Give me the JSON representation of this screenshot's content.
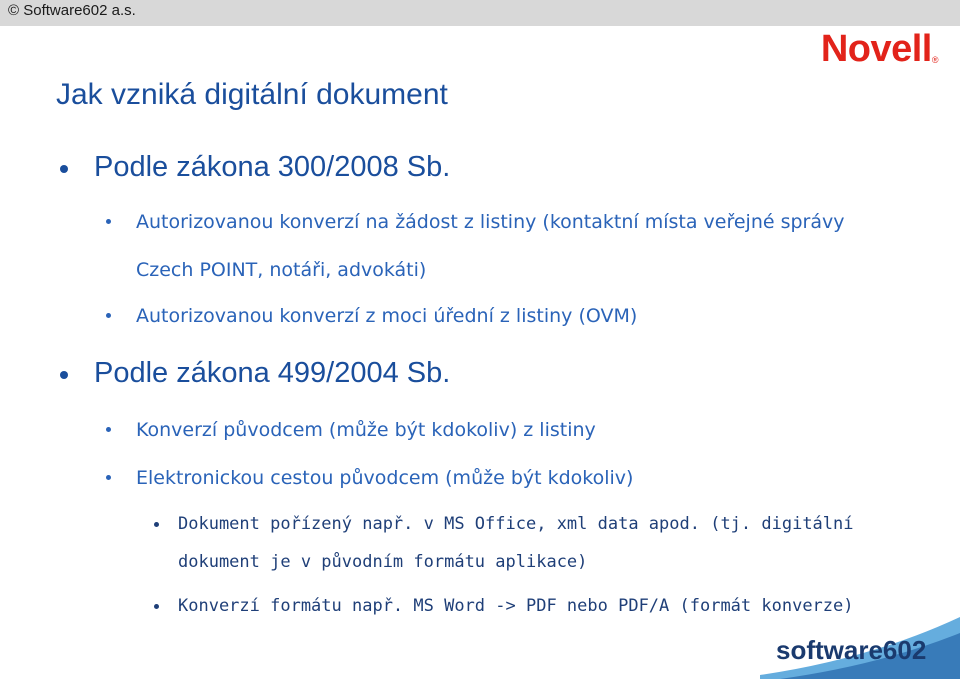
{
  "header": {
    "copyright": "© Software602 a.s."
  },
  "brand": {
    "novell": "Novell",
    "novell_reg": "®",
    "software602": "software602"
  },
  "title": "Jak vzniká digitální dokument",
  "bullets": [
    {
      "text": "Podle zákona 300/2008 Sb."
    },
    {
      "text": "Autorizovanou konverzí na žádost z listiny (kontaktní místa veřejné správy Czech POINT, notáři, advokáti)"
    },
    {
      "text": "Autorizovanou konverzí z moci úřední z listiny (OVM)"
    },
    {
      "text": "Podle zákona 499/2004 Sb."
    },
    {
      "text": "Konverzí původcem (může být kdokoliv) z listiny"
    },
    {
      "text": "Elektronickou cestou původcem (může být kdokoliv)"
    },
    {
      "text": "Dokument pořízený např. v MS Office, xml data apod. (tj. digitální dokument je v původním formátu aplikace)"
    },
    {
      "text": "Konverzí formátu např. MS Word -> PDF nebo PDF/A (formát konverze)"
    }
  ],
  "colors": {
    "title": "#1a4e9c",
    "novell_red": "#e2231a",
    "sw602_navy": "#1a3a6e",
    "sw602_teal": "#4a9fd8"
  }
}
